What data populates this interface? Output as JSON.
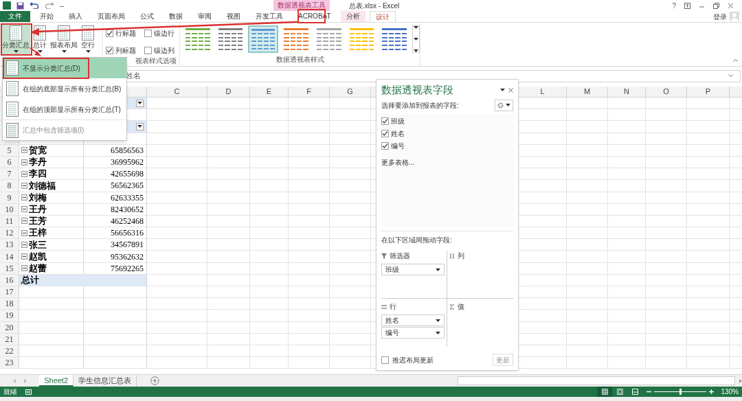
{
  "title_bar": {
    "context_label": "数据透视表工具",
    "title": "总表.xlsx - Excel",
    "help": "?"
  },
  "tabs": [
    {
      "label": "文件",
      "kind": "file",
      "selected": false
    },
    {
      "label": "开始",
      "kind": "normal",
      "selected": false
    },
    {
      "label": "插入",
      "kind": "normal",
      "selected": false
    },
    {
      "label": "页面布局",
      "kind": "normal",
      "selected": false
    },
    {
      "label": "公式",
      "kind": "normal",
      "selected": false
    },
    {
      "label": "数据",
      "kind": "normal",
      "selected": false
    },
    {
      "label": "审阅",
      "kind": "normal",
      "selected": false
    },
    {
      "label": "视图",
      "kind": "normal",
      "selected": false
    },
    {
      "label": "开发工具",
      "kind": "normal",
      "selected": false
    },
    {
      "label": "ACROBAT",
      "kind": "normal",
      "selected": false
    },
    {
      "label": "分析",
      "kind": "context",
      "selected": false
    },
    {
      "label": "设计",
      "kind": "context",
      "selected": true
    }
  ],
  "sign_in": "登录",
  "ribbon": {
    "layout_buttons": [
      {
        "label": "分类汇总",
        "active": true
      },
      {
        "label": "总计",
        "active": false
      },
      {
        "label": "报表布局",
        "active": false
      },
      {
        "label": "空行",
        "active": false
      }
    ],
    "style_options": {
      "group_label": "视表样式选项",
      "options": [
        {
          "label": "行标题",
          "checked": true
        },
        {
          "label": "镶边行",
          "checked": false
        },
        {
          "label": "列标题",
          "checked": true
        },
        {
          "label": "镶边列",
          "checked": false
        }
      ]
    },
    "styles": {
      "group_label": "数据透视表样式",
      "swatches": [
        {
          "color": "#70ad47",
          "selected": false
        },
        {
          "color": "#7f7f7f",
          "selected": false
        },
        {
          "color": "#5b9bd5",
          "selected": true
        },
        {
          "color": "#ed7d31",
          "selected": false
        },
        {
          "color": "#a5a5a5",
          "selected": false
        },
        {
          "color": "#ffc000",
          "selected": false
        },
        {
          "color": "#4472c4",
          "selected": false
        }
      ]
    }
  },
  "subtotal_menu": {
    "items": [
      {
        "label": "不显示分类汇总(D)",
        "selected": true,
        "disabled": false
      },
      {
        "label": "在组的底部显示所有分类汇总(B)",
        "selected": false,
        "disabled": false
      },
      {
        "label": "在组的顶部显示所有分类汇总(T)",
        "selected": false,
        "disabled": false
      },
      {
        "label": "汇总中包含筛选项(I)",
        "selected": false,
        "disabled": true
      }
    ]
  },
  "formula_bar": {
    "value": "姓名"
  },
  "columns": [
    {
      "label": "C"
    },
    {
      "label": "D"
    },
    {
      "label": "E"
    },
    {
      "label": "F"
    },
    {
      "label": "G"
    },
    {
      "label": "L"
    },
    {
      "label": "M"
    },
    {
      "label": "N"
    },
    {
      "label": "O"
    },
    {
      "label": "P"
    }
  ],
  "rows": [
    {
      "kind": "filter"
    },
    {
      "kind": "blank"
    },
    {
      "kind": "header"
    },
    {
      "kind": "blank"
    },
    {
      "kind": "item",
      "number": "5",
      "name": "贺宽",
      "value": "65856563"
    },
    {
      "kind": "item",
      "number": "6",
      "name": "李丹",
      "value": "36995962"
    },
    {
      "kind": "item",
      "number": "7",
      "name": "李四",
      "value": "42655698"
    },
    {
      "kind": "item",
      "number": "8",
      "name": "刘德福",
      "value": "56562365"
    },
    {
      "kind": "item",
      "number": "9",
      "name": "刘梅",
      "value": "62633355"
    },
    {
      "kind": "item",
      "number": "10",
      "name": "王丹",
      "value": "82430652"
    },
    {
      "kind": "item",
      "number": "11",
      "name": "王芳",
      "value": "46252468"
    },
    {
      "kind": "item",
      "number": "12",
      "name": "王梓",
      "value": "56656316"
    },
    {
      "kind": "item",
      "number": "13",
      "name": "张三",
      "value": "34567891"
    },
    {
      "kind": "item",
      "number": "14",
      "name": "赵凯",
      "value": "95362632"
    },
    {
      "kind": "item",
      "number": "15",
      "name": "赵蕾",
      "value": "75692265"
    },
    {
      "kind": "total",
      "number": "16",
      "name": "总计"
    },
    {
      "kind": "empty",
      "number": "17"
    },
    {
      "kind": "empty",
      "number": "18"
    },
    {
      "kind": "empty",
      "number": "19"
    },
    {
      "kind": "empty",
      "number": "20"
    },
    {
      "kind": "empty",
      "number": "21"
    },
    {
      "kind": "empty",
      "number": "22"
    },
    {
      "kind": "empty",
      "number": "23"
    }
  ],
  "field_panel": {
    "title": "数据透视表字段",
    "subtitle": "选择要添加到报表的字段:",
    "fields": [
      {
        "label": "班级",
        "checked": true
      },
      {
        "label": "姓名",
        "checked": true
      },
      {
        "label": "编号",
        "checked": true
      }
    ],
    "more": "更多表格...",
    "drag_hint": "在以下区域间拖动字段:",
    "areas": [
      {
        "kind": "filter",
        "label": "筛选器",
        "items": [
          "班级"
        ]
      },
      {
        "kind": "columns",
        "label": "列"
      },
      {
        "kind": "rows",
        "label": "行",
        "items": [
          "姓名",
          "编号"
        ]
      },
      {
        "kind": "values",
        "label": "值"
      }
    ],
    "defer": {
      "label": "推迟布局更新",
      "checked": false
    },
    "update": {
      "label": "更新",
      "disabled": true
    }
  },
  "sheet_tabs": [
    {
      "label": "Sheet2",
      "selected": true
    },
    {
      "label": "学生信息汇总表",
      "selected": false
    }
  ],
  "status_bar": {
    "status": "就绪",
    "views": [
      {
        "kind": "normal",
        "selected": true
      },
      {
        "kind": "page_layout",
        "selected": false
      },
      {
        "kind": "page_break",
        "selected": false
      }
    ],
    "zoom_slider": {
      "level": 0.5
    },
    "zoom": "130%"
  }
}
